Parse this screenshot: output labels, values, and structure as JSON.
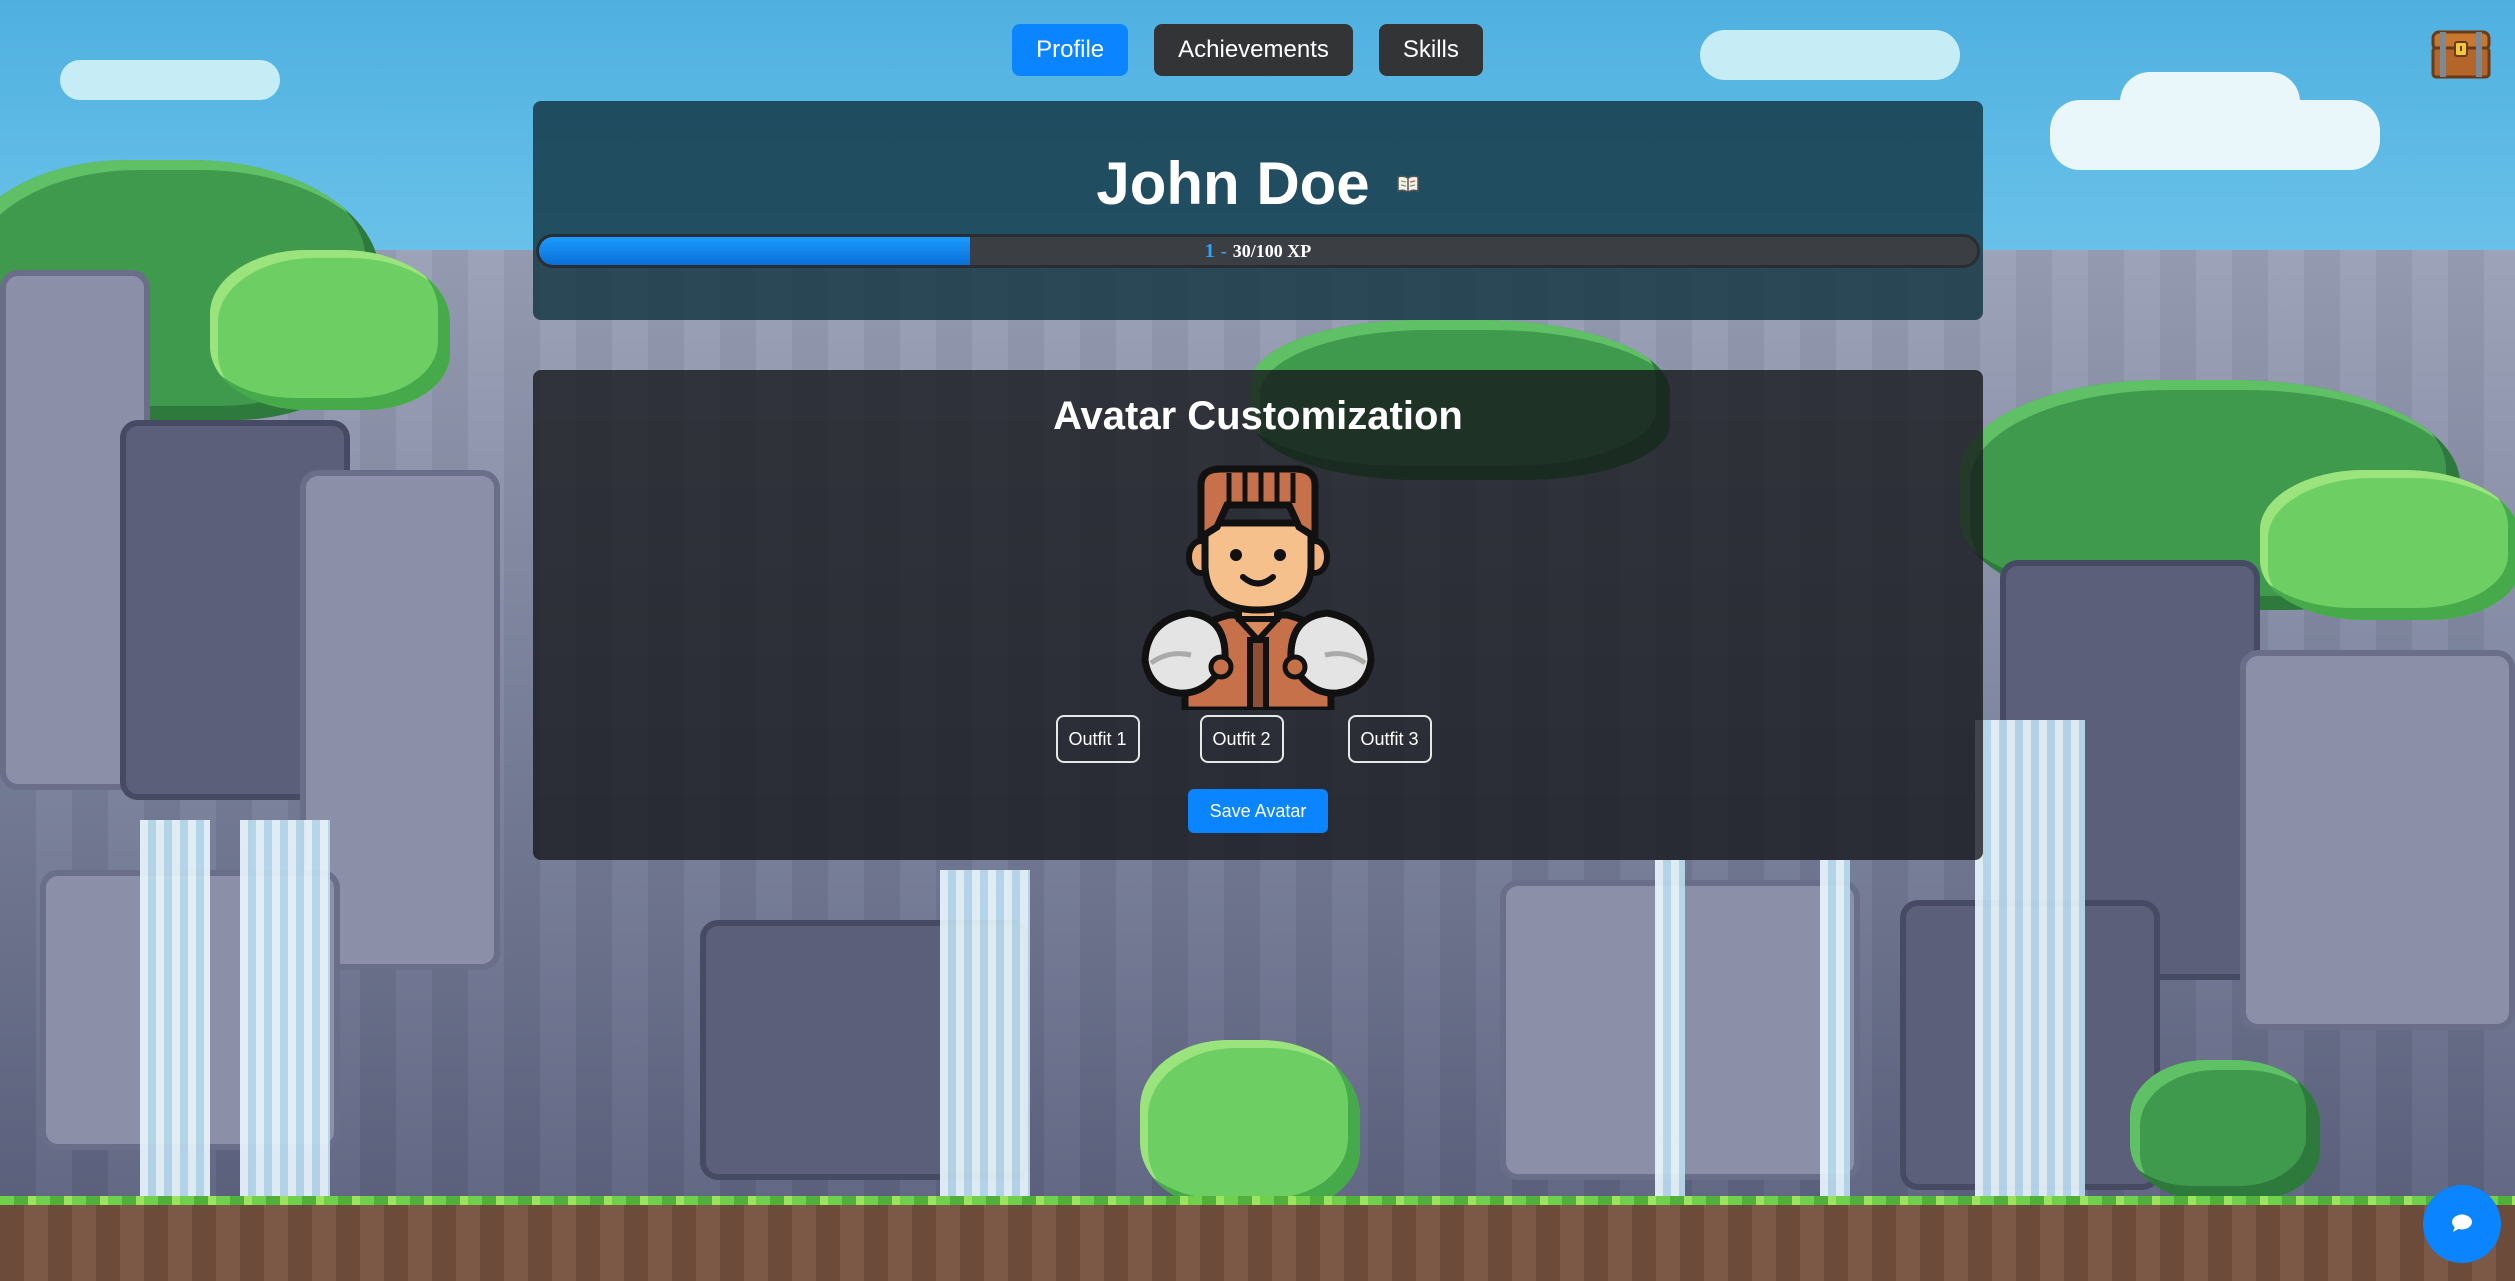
{
  "nav": {
    "tabs": [
      {
        "label": "Profile",
        "active": true
      },
      {
        "label": "Achievements",
        "active": false
      },
      {
        "label": "Skills",
        "active": false
      }
    ]
  },
  "header_icons": {
    "inventory": "treasure-chest-icon"
  },
  "profile": {
    "name": "John Doe",
    "name_icon": "book-icon",
    "level": "1",
    "separator": "-",
    "xp_text": "30/100 XP",
    "xp_current": 30,
    "xp_max": 100
  },
  "avatar": {
    "title": "Avatar Customization",
    "image": "warrior-avatar",
    "outfits": [
      "Outfit 1",
      "Outfit 2",
      "Outfit 3"
    ],
    "save_label": "Save Avatar"
  },
  "chat": {
    "icon": "chat-bubble-icon"
  },
  "colors": {
    "accent": "#0a84ff",
    "button_dark": "#333436",
    "profile_card": "#12343e",
    "avatar_card": "#14161a"
  }
}
